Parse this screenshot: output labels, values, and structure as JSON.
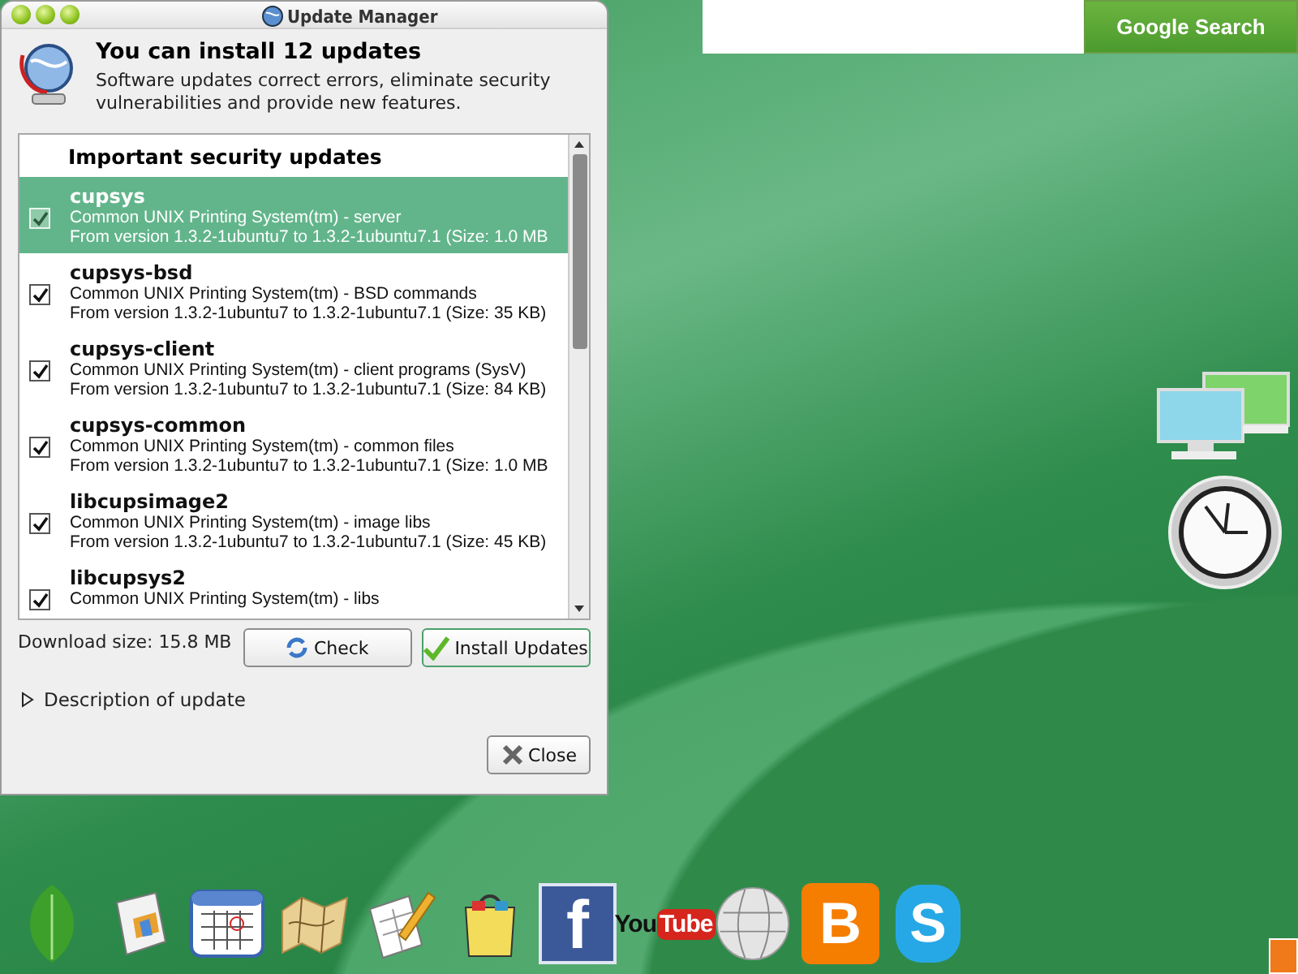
{
  "window": {
    "title": "Update Manager"
  },
  "header": {
    "title": "You can install 12 updates",
    "description": "Software updates correct errors, eliminate security vulnerabilities and provide new features."
  },
  "updates": {
    "group": "Important security updates",
    "items": [
      {
        "name": "cupsys",
        "description": "Common UNIX Printing System(tm) - server",
        "version": "From version 1.3.2-1ubuntu7 to 1.3.2-1ubuntu7.1 (Size: 1.0 MB",
        "checked": true,
        "selected": true
      },
      {
        "name": "cupsys-bsd",
        "description": "Common UNIX Printing System(tm) - BSD commands",
        "version": "From version 1.3.2-1ubuntu7 to 1.3.2-1ubuntu7.1 (Size: 35 KB)",
        "checked": true,
        "selected": false
      },
      {
        "name": "cupsys-client",
        "description": "Common UNIX Printing System(tm) - client programs (SysV)",
        "version": "From version 1.3.2-1ubuntu7 to 1.3.2-1ubuntu7.1 (Size: 84 KB)",
        "checked": true,
        "selected": false
      },
      {
        "name": "cupsys-common",
        "description": "Common UNIX Printing System(tm) - common files",
        "version": "From version 1.3.2-1ubuntu7 to 1.3.2-1ubuntu7.1 (Size: 1.0 MB",
        "checked": true,
        "selected": false
      },
      {
        "name": "libcupsimage2",
        "description": "Common UNIX Printing System(tm) - image libs",
        "version": "From version 1.3.2-1ubuntu7 to 1.3.2-1ubuntu7.1 (Size: 45 KB)",
        "checked": true,
        "selected": false
      },
      {
        "name": "libcupsys2",
        "description": "Common UNIX Printing System(tm) - libs",
        "checked": true,
        "selected": false
      }
    ]
  },
  "download_size": "Download size: 15.8 MB",
  "buttons": [
    {
      "kind": "check",
      "label": "Check"
    },
    {
      "kind": "install",
      "label": "Install Updates"
    }
  ],
  "expander": {
    "label": "Description of update",
    "expanded": false
  },
  "close": {
    "label": "Close"
  },
  "search": {
    "button": "Google Search"
  },
  "dock": [
    {
      "kind": "leaf"
    },
    {
      "kind": "news"
    },
    {
      "kind": "calendar"
    },
    {
      "kind": "map"
    },
    {
      "kind": "sheet"
    },
    {
      "kind": "bag"
    },
    {
      "kind": "facebook",
      "text": "f"
    },
    {
      "kind": "youtube",
      "text": "You",
      "text2": "Tube"
    },
    {
      "kind": "globe"
    },
    {
      "kind": "blogger",
      "text": "B"
    },
    {
      "kind": "skype",
      "text": "S"
    }
  ]
}
